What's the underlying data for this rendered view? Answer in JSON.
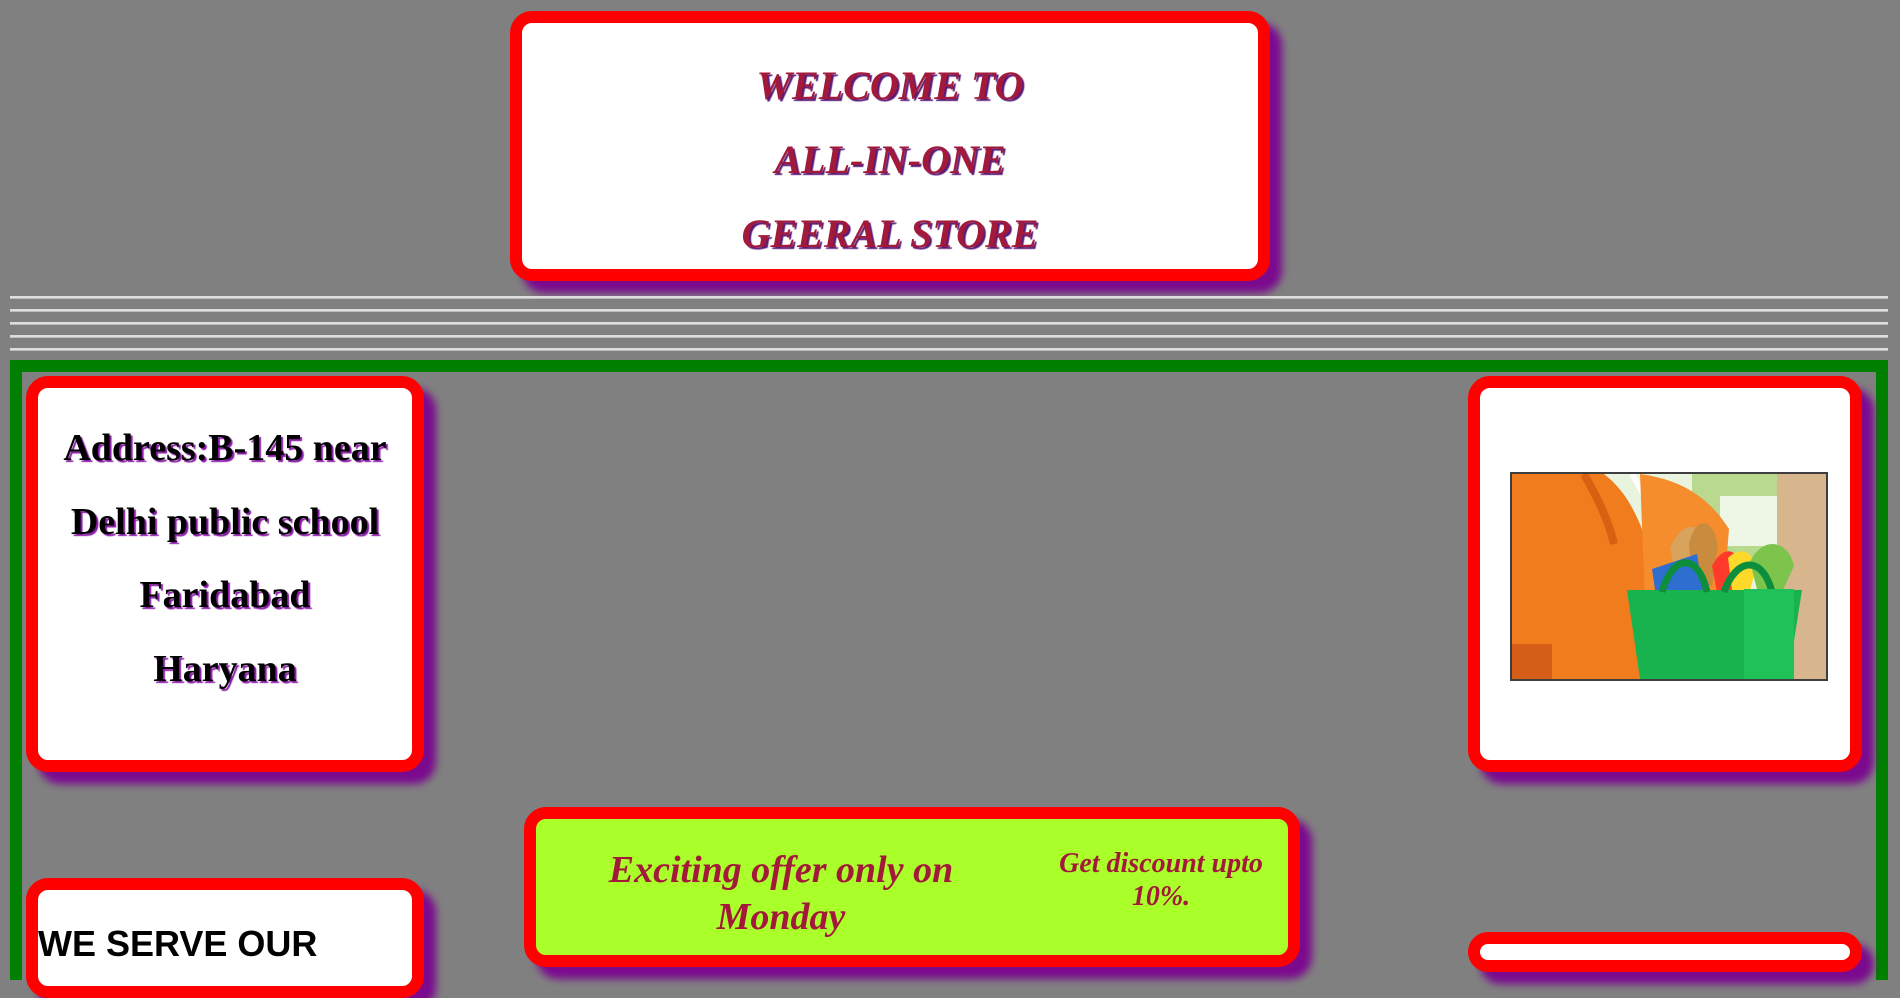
{
  "header": {
    "line1": "WELCOME TO",
    "line2": "ALL-IN-ONE",
    "line3": "GEERAL STORE"
  },
  "address": {
    "line1": "Address:B-145 near",
    "line2": "Delhi public school",
    "line3": "Faridabad",
    "line4": "Haryana"
  },
  "offer": {
    "main": "Exciting offer only on Monday",
    "discount": "Get discount upto 10%."
  },
  "serve": {
    "heading": "WE SERVE OUR"
  },
  "colors": {
    "page_background": "#808080",
    "card_border": "#ff0000",
    "card_shadow": "#7b0a8f",
    "main_border": "#008000",
    "offer_background": "#aaff2a",
    "title_text": "#a2193a"
  },
  "image": {
    "semantic": "grocery-delivery-photo"
  }
}
